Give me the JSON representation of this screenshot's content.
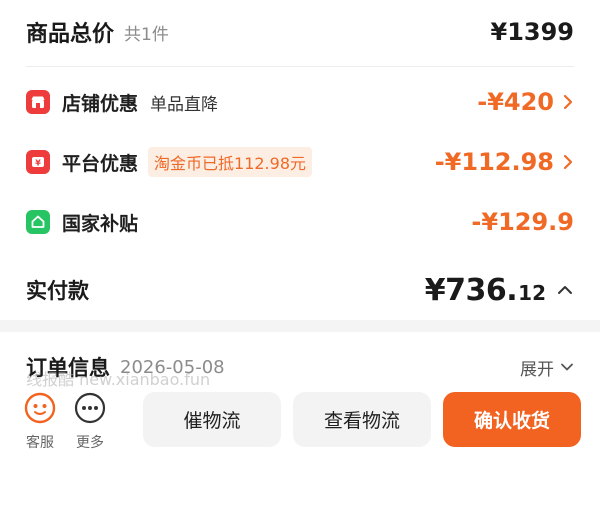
{
  "summary": {
    "total_label": "商品总价",
    "count": "共1件",
    "total_price": "¥1399"
  },
  "discounts": [
    {
      "icon": "store-icon",
      "label": "店铺优惠",
      "sub": "单品直降",
      "amount": "-¥420",
      "color": "#ee3b3b"
    },
    {
      "icon": "coin-icon",
      "label": "平台优惠",
      "pill": "淘金币已抵112.98元",
      "amount": "-¥112.98",
      "color": "#ee3b3b"
    },
    {
      "icon": "house-icon",
      "label": "国家补贴",
      "amount": "-¥129.9",
      "color": "#27c464"
    }
  ],
  "payment": {
    "label": "实付款",
    "amount_main": "¥736.",
    "amount_cents": "12"
  },
  "order": {
    "title": "订单信息",
    "date": "2026-05-08",
    "expand": "展开"
  },
  "watermark": "线报酷 new.xianbao.fun",
  "bottom": {
    "service_label": "客服",
    "more_label": "更多",
    "urge_label": "催物流",
    "track_label": "查看物流",
    "confirm_label": "确认收货"
  },
  "colors": {
    "accent": "#f26322",
    "discount": "#f06a26"
  }
}
